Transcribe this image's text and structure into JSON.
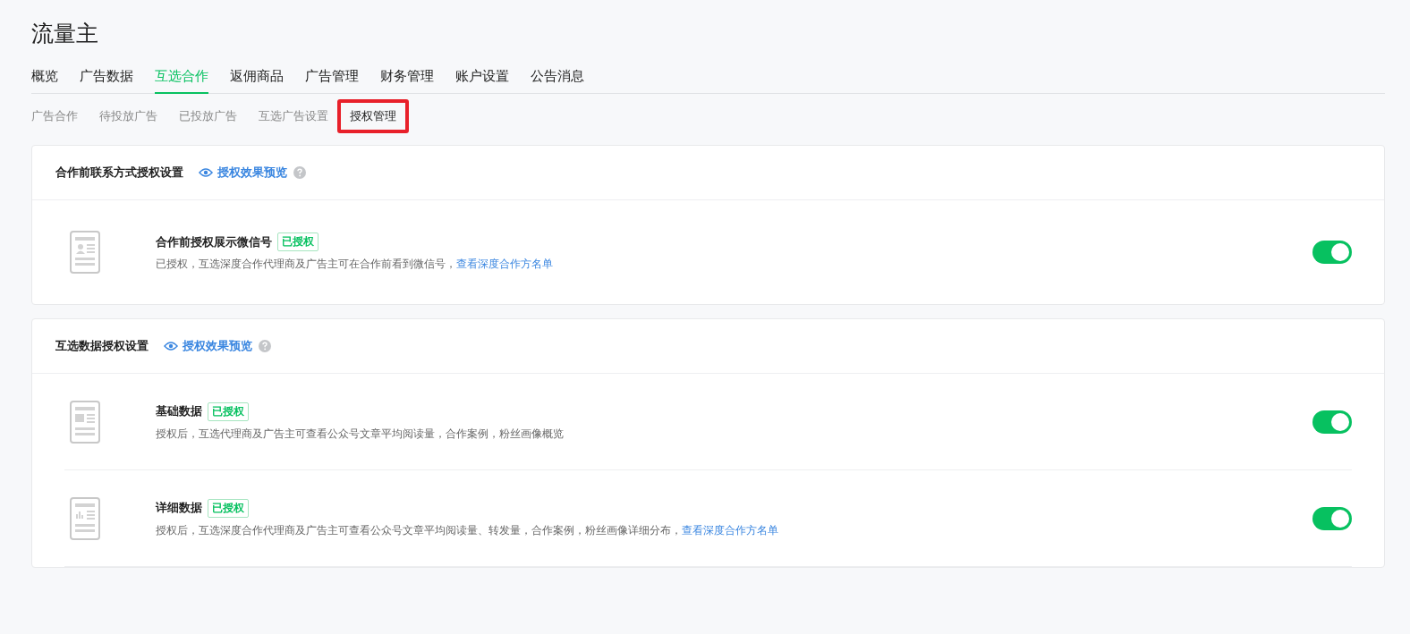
{
  "title": "流量主",
  "tabs": [
    {
      "label": "概览",
      "selected": false
    },
    {
      "label": "广告数据",
      "selected": false
    },
    {
      "label": "互选合作",
      "selected": true
    },
    {
      "label": "返佣商品",
      "selected": false
    },
    {
      "label": "广告管理",
      "selected": false
    },
    {
      "label": "财务管理",
      "selected": false
    },
    {
      "label": "账户设置",
      "selected": false
    },
    {
      "label": "公告消息",
      "selected": false
    }
  ],
  "subtabs": [
    {
      "label": "广告合作",
      "selected": false,
      "highlighted": false
    },
    {
      "label": "待投放广告",
      "selected": false,
      "highlighted": false
    },
    {
      "label": "已投放广告",
      "selected": false,
      "highlighted": false
    },
    {
      "label": "互选广告设置",
      "selected": false,
      "highlighted": false
    },
    {
      "label": "授权管理",
      "selected": true,
      "highlighted": true
    }
  ],
  "sections": [
    {
      "title": "合作前联系方式授权设置",
      "preview_link": "授权效果预览",
      "items": [
        {
          "kind": "contact",
          "name": "合作前授权展示微信号",
          "status": "已授权",
          "description": "已授权，互选深度合作代理商及广告主可在合作前看到微信号，",
          "link": "查看深度合作方名单",
          "on": true
        }
      ]
    },
    {
      "title": "互选数据授权设置",
      "preview_link": "授权效果预览",
      "items": [
        {
          "kind": "basic",
          "name": "基础数据",
          "status": "已授权",
          "description": "授权后，互选代理商及广告主可查看公众号文章平均阅读量，合作案例，粉丝画像概览",
          "on": true
        },
        {
          "kind": "detail",
          "name": "详细数据",
          "status": "已授权",
          "description": "授权后，互选深度合作代理商及广告主可查看公众号文章平均阅读量、转发量，合作案例，粉丝画像详细分布，",
          "link": "查看深度合作方名单",
          "on": true
        }
      ]
    }
  ]
}
